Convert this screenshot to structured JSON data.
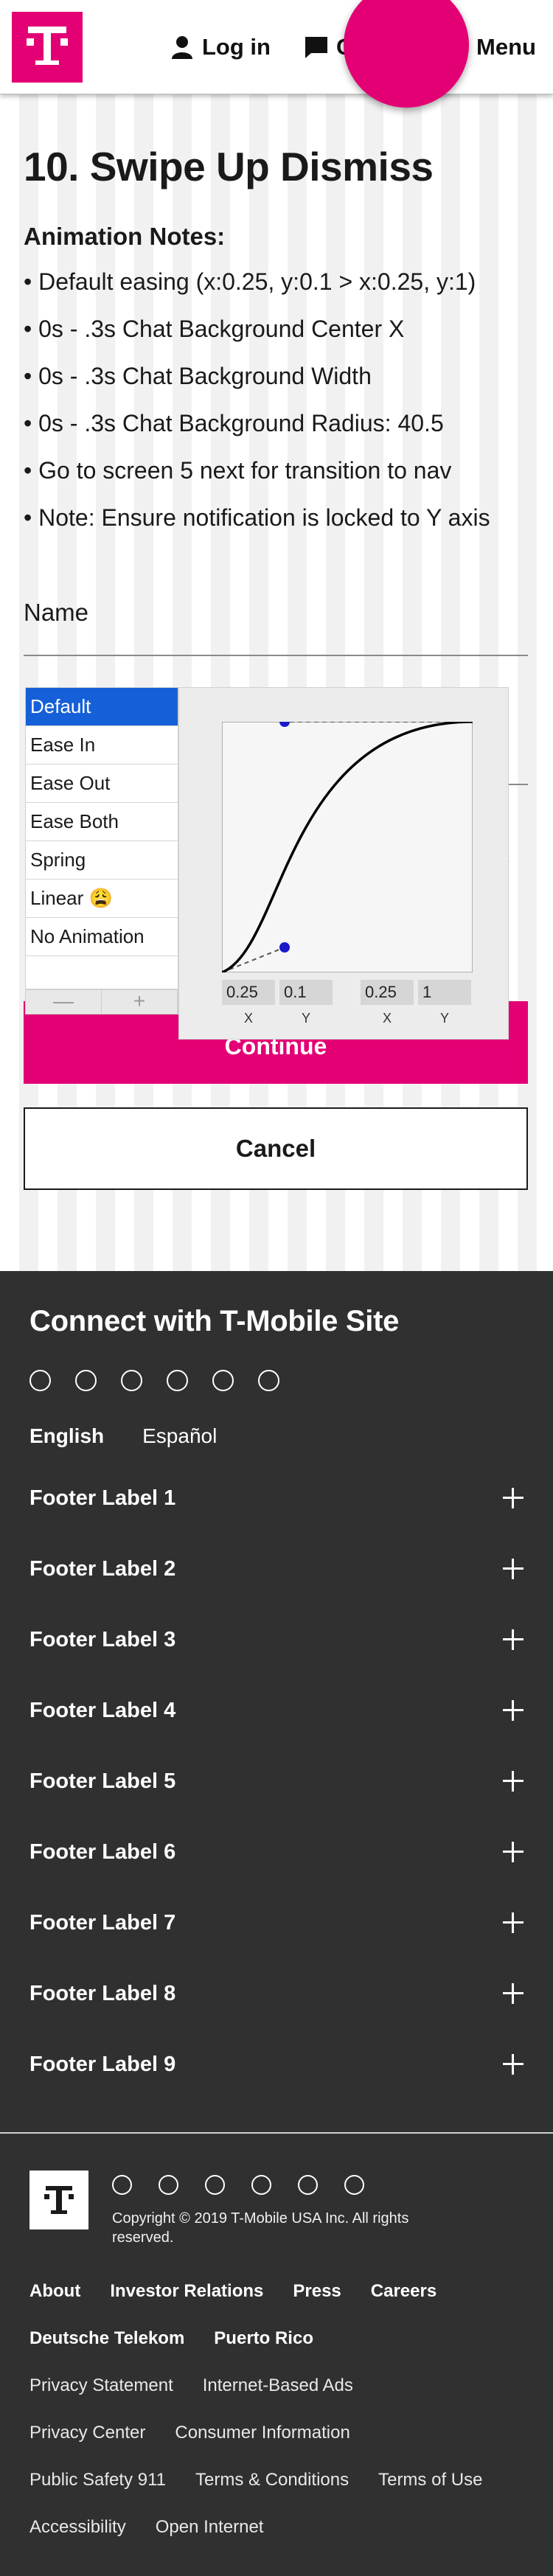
{
  "header": {
    "login_label": "Log in",
    "chat_label": "Chat",
    "menu_label": "Menu",
    "brand_color": "#e20074"
  },
  "page": {
    "title": "10. Swipe Up Dismiss",
    "notes_heading": "Animation Notes:",
    "notes": [
      "• Default easing (x:0.25, y:0.1 > x:0.25, y:1)",
      "• 0s - .3s Chat Background Center X",
      "• 0s - .3s Chat Background Width",
      "• 0s - .3s Chat Background Radius: 40.5",
      "• Go to screen 5 next for transition to nav",
      "• Note: Ensure notification is locked to Y axis"
    ],
    "name_label": "Name",
    "arrow_text": "›",
    "continue_label": "Continue",
    "cancel_label": "Cancel"
  },
  "easing_popup": {
    "presets": [
      "Default",
      "Ease In",
      "Ease Out",
      "Ease Both",
      "Spring",
      "Linear 😩",
      "No Animation",
      ""
    ],
    "selected_preset": "Default",
    "remove_label": "—",
    "add_label": "+",
    "point1": {
      "x": "0.25",
      "y": "0.1"
    },
    "point2": {
      "x": "0.25",
      "y": "1"
    },
    "x_label": "X",
    "y_label": "Y",
    "handle_color": "#1a1acc",
    "selection_color": "#1560d8"
  },
  "footer": {
    "title": "Connect with T-Mobile Site",
    "languages": [
      "English",
      "Español"
    ],
    "accordion": [
      "Footer Label 1",
      "Footer Label 2",
      "Footer Label 3",
      "Footer Label 4",
      "Footer Label 5",
      "Footer Label 6",
      "Footer Label 7",
      "Footer Label 8",
      "Footer Label 9"
    ],
    "copyright": "Copyright © 2019 T-Mobile USA Inc. All rights reserved.",
    "primary_links_row1": [
      "About",
      "Investor Relations",
      "Press",
      "Careers"
    ],
    "primary_links_row2": [
      "Deutsche Telekom",
      "Puerto Rico"
    ],
    "secondary_links": [
      [
        "Privacy Statement",
        "Internet-Based Ads"
      ],
      [
        "Privacy Center",
        "Consumer Information"
      ],
      [
        "Public Safety 911",
        "Terms & Conditions",
        "Terms of Use"
      ],
      [
        "Accessibility",
        "Open Internet"
      ]
    ],
    "background_color": "#303030"
  }
}
